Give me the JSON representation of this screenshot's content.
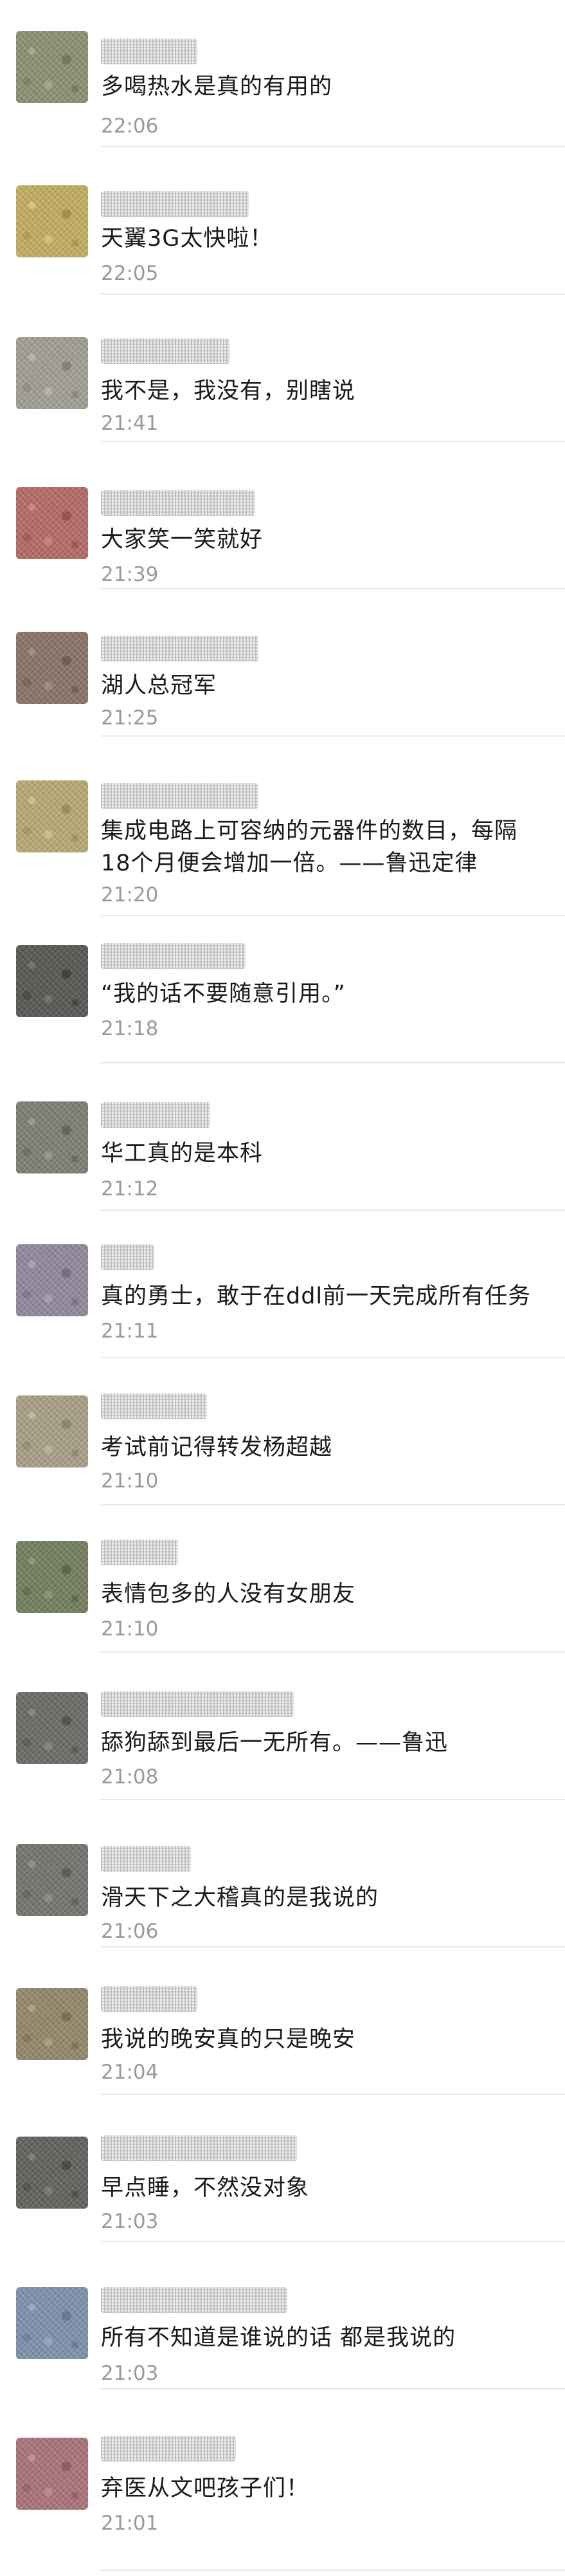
{
  "comments": [
    {
      "text": "多喝热水是真的有用的",
      "time": "22:06",
      "tint": "#7f8a5a"
    },
    {
      "text": "天翼3G太快啦！",
      "time": "22:05",
      "tint": "#d9b840"
    },
    {
      "text": "我不是，我没有，别瞎说",
      "time": "21:41",
      "tint": "#a49e90"
    },
    {
      "text": "大家笑一笑就好",
      "time": "21:39",
      "tint": "#c24848"
    },
    {
      "text": "湖人总冠军",
      "time": "21:25",
      "tint": "#7a5a4a"
    },
    {
      "text": "集成电路上可容纳的元器件的数目，每隔\n18个月便会增加一倍。——鲁迅定律",
      "time": "21:20",
      "tint": "#c8b060"
    },
    {
      "text": "“我的话不要随意引用。”",
      "time": "21:18",
      "tint": "#2a2a2a"
    },
    {
      "text": "华工真的是本科",
      "time": "21:12",
      "tint": "#6a6a60"
    },
    {
      "text": "真的勇士，敢于在ddl前一天完成所有任务",
      "time": "21:11",
      "tint": "#8a7aa0"
    },
    {
      "text": "考试前记得转发杨超越",
      "time": "21:10",
      "tint": "#b0a080"
    },
    {
      "text": "表情包多的人没有女朋友",
      "time": "21:10",
      "tint": "#5a6a3a"
    },
    {
      "text": "舔狗舔到最后一无所有。——鲁迅",
      "time": "21:08",
      "tint": "#4a4a4a"
    },
    {
      "text": "滑天下之大稽真的是我说的",
      "time": "21:06",
      "tint": "#5a5a5a"
    },
    {
      "text": "我说的晚安真的只是晚安",
      "time": "21:04",
      "tint": "#8a7a50"
    },
    {
      "text": "早点睡，不然没对象",
      "time": "21:03",
      "tint": "#3a3a3a"
    },
    {
      "text": "所有不知道是谁说的话 都是我说的",
      "time": "21:03",
      "tint": "#6a8aba"
    },
    {
      "text": "弃医从文吧孩子们！",
      "time": "21:01",
      "tint": "#b05a6a"
    }
  ]
}
